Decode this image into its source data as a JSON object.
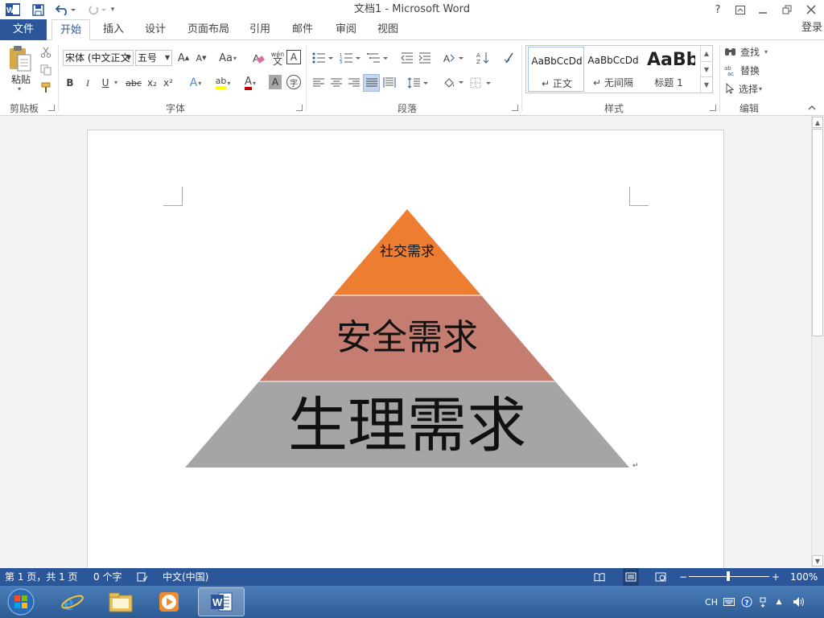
{
  "window": {
    "title": "文档1 - Microsoft Word"
  },
  "tabs": {
    "file": "文件",
    "home": "开始",
    "insert": "插入",
    "design": "设计",
    "layout": "页面布局",
    "references": "引用",
    "mailings": "邮件",
    "review": "审阅",
    "view": "视图",
    "login": "登录"
  },
  "clipboard": {
    "paste": "粘贴",
    "group": "剪贴板"
  },
  "font": {
    "name": "宋体 (中文正文",
    "size": "五号",
    "change_case": "Aa",
    "pinyin_top": "wén",
    "pinyin_char": "文",
    "border_char": "A",
    "bold": "B",
    "italic": "I",
    "underline": "U",
    "strike": "abc",
    "sub": "x₂",
    "sup": "x²",
    "effects": "A",
    "highlight": "ab",
    "color": "A",
    "shade": "A",
    "enclose": "字",
    "group": "字体"
  },
  "paragraph": {
    "group": "段落"
  },
  "styles": {
    "normal_preview": "AaBbCcDd",
    "normal": "正文",
    "nospace_preview": "AaBbCcDd",
    "nospace": "无间隔",
    "h1_preview": "AaBb",
    "h1": "标题 1",
    "group": "样式"
  },
  "editing": {
    "find": "查找",
    "replace": "替换",
    "select": "选择",
    "group": "编辑"
  },
  "pyramid": {
    "levels": [
      {
        "label": "社交需求",
        "color": "#ed7d31"
      },
      {
        "label": "安全需求",
        "color": "#c47d70"
      },
      {
        "label": "生理需求",
        "color": "#a5a5a5"
      }
    ]
  },
  "status": {
    "page": "第 1 页，共 1 页",
    "words": "0 个字",
    "lang": "中文(中国)",
    "zoom": "100%",
    "zoom_minus": "−",
    "zoom_plus": "+"
  },
  "tray": {
    "ime": "CH"
  },
  "colors": {
    "accent": "#2b579a",
    "highlight": "#ffff00",
    "font_red": "#c00000"
  }
}
